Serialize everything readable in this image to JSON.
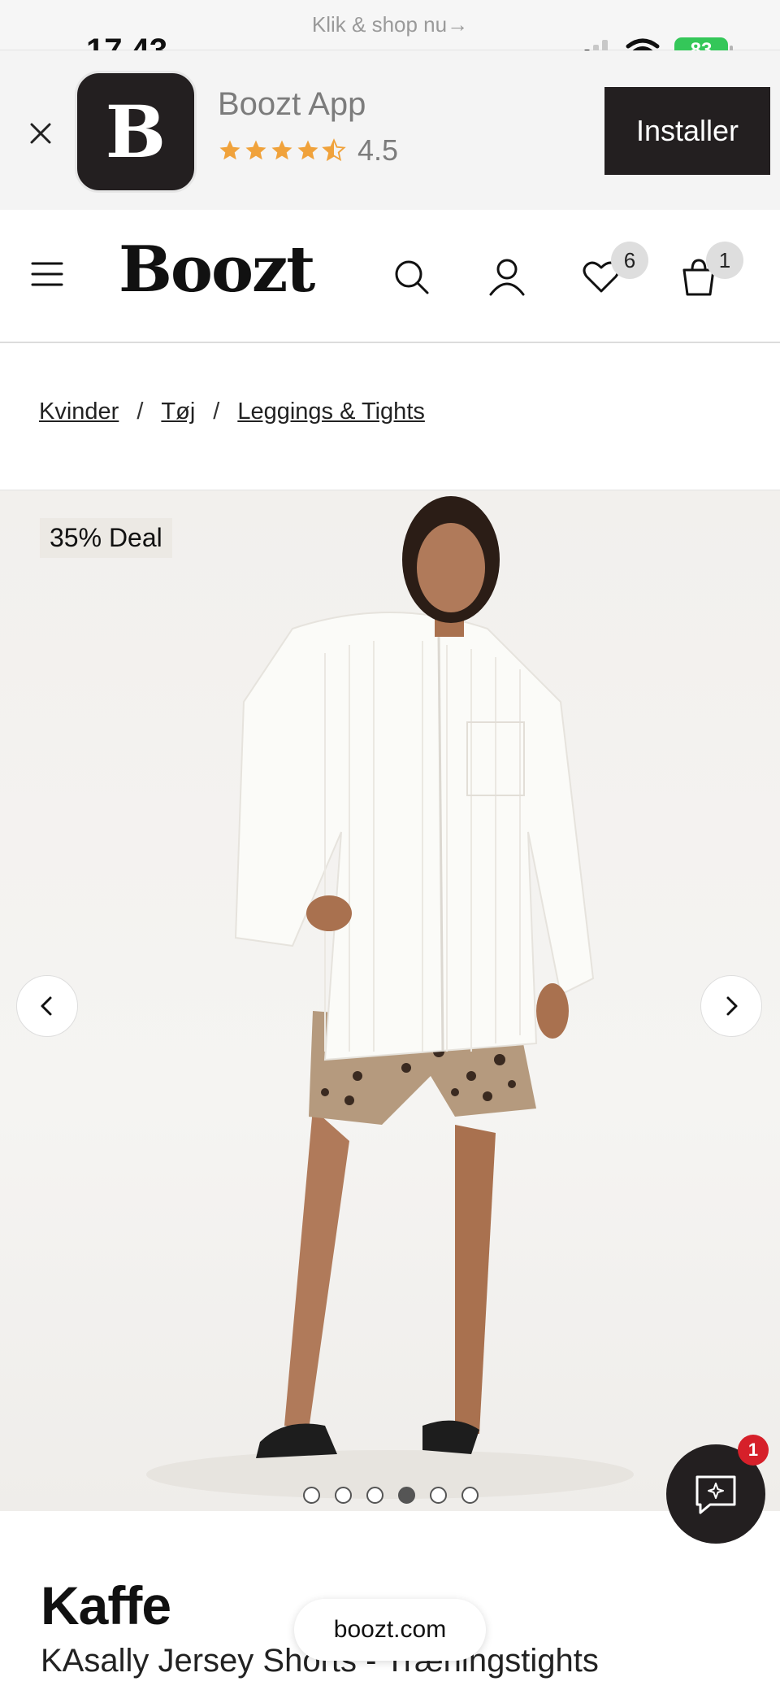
{
  "promo": {
    "text": "Klik & shop nu→"
  },
  "status_bar": {
    "time": "17.43",
    "battery": "83"
  },
  "app_banner": {
    "icon_letter": "B",
    "name": "Boozt App",
    "rating": "4.5",
    "install_label": "Installer"
  },
  "header": {
    "logo": "Boozt",
    "wishlist_count": "6",
    "cart_count": "1"
  },
  "breadcrumb": {
    "items": [
      "Kvinder",
      "Tøj",
      "Leggings & Tights"
    ],
    "separator": "/"
  },
  "gallery": {
    "deal_label": "35% Deal",
    "image_count": 6,
    "active_index": 3
  },
  "chat": {
    "badge": "1"
  },
  "product": {
    "brand": "Kaffe",
    "name": "KAsally Jersey Shorts - Træningstights"
  },
  "browser": {
    "url": "boozt.com"
  },
  "colors": {
    "dark": "#231f20",
    "badge_red": "#d6202a",
    "star": "#f0a23b",
    "battery_green": "#34c759"
  }
}
